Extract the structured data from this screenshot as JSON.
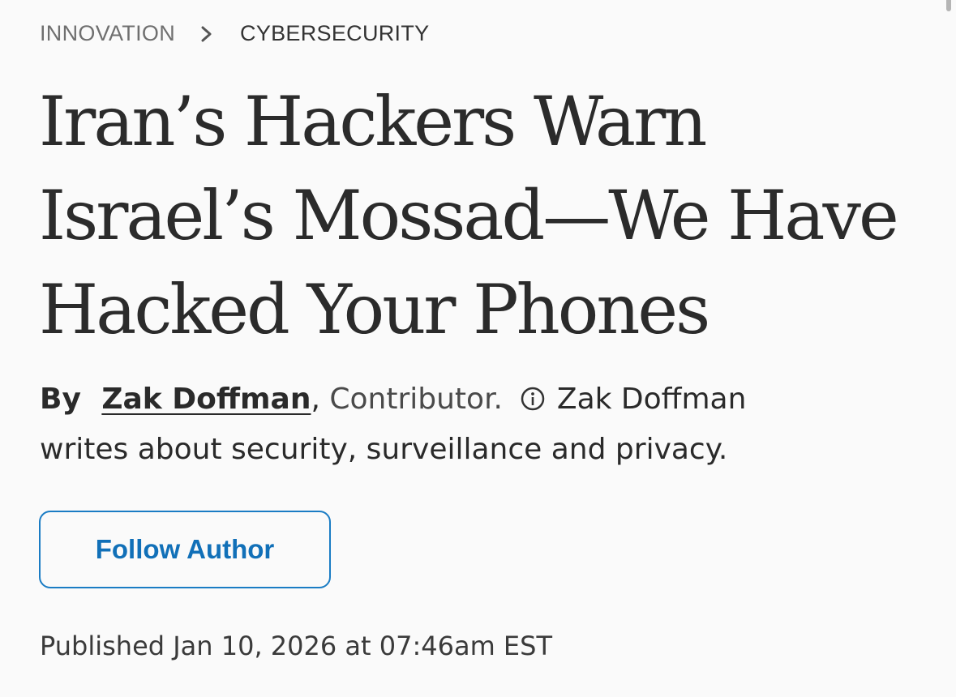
{
  "breadcrumb": {
    "parent": "INNOVATION",
    "current": "CYBERSECURITY"
  },
  "article": {
    "headline": "Iran’s Hackers Warn Israel’s Mossad—We Have Hacked Your Phones",
    "byline": {
      "by_label": "By",
      "author_name": "Zak Doffman",
      "comma": ",",
      "role": "Contributor.",
      "bio": "Zak Doffman writes about security, surveillance and privacy."
    },
    "follow_button_label": "Follow Author",
    "published": "Published Jan 10, 2026 at 07:46am EST"
  },
  "icons": {
    "breadcrumb_separator": "chevron-right-icon",
    "bio_info": "info-icon"
  },
  "colors": {
    "accent": "#1a7cc4",
    "background": "#fafafa",
    "text": "#2b2b2b"
  }
}
